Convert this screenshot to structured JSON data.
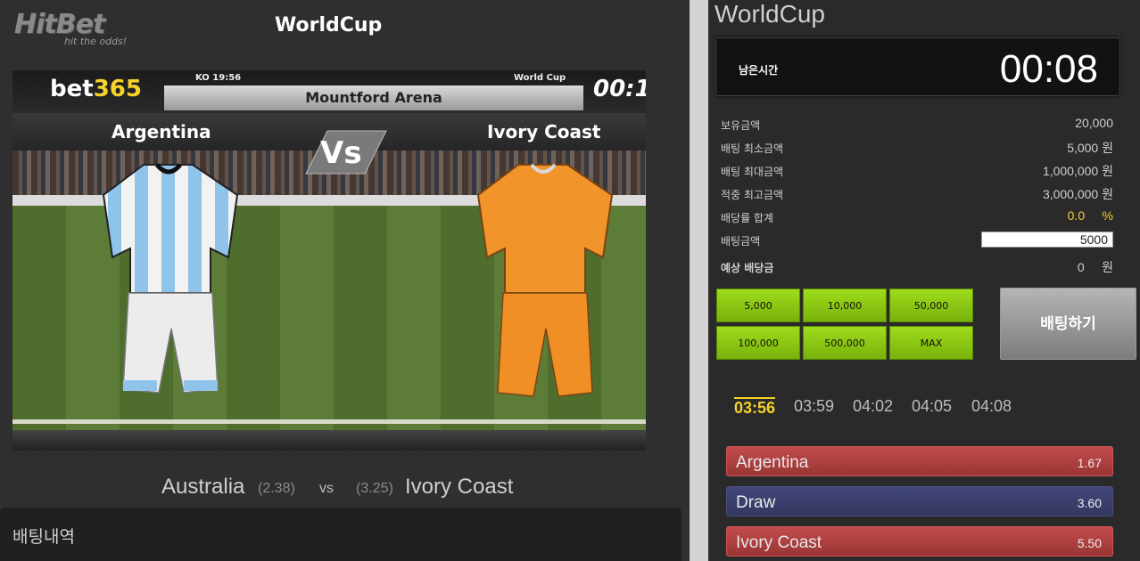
{
  "header": {
    "logo_text": "HitBet",
    "logo_tagline": "hit the odds!",
    "game_title": "WorldCup"
  },
  "video": {
    "brand_prefix": "bet",
    "brand_suffix": "365",
    "kickoff": "KO 19:56",
    "competition": "World Cup",
    "arena": "Mountford Arena",
    "timer": "00:1",
    "team_home": "Argentina",
    "team_away": "Ivory Coast",
    "vs_text": "Vs"
  },
  "match": {
    "team1": "Australia",
    "odd1": "(2.38)",
    "vs": "vs",
    "odd2": "(3.25)",
    "team2": "Ivory Coast"
  },
  "history": {
    "title": "배팅내역"
  },
  "panel": {
    "title": "WorldCup",
    "remaining_label": "남은시간",
    "remaining_time": "00:08",
    "rows": {
      "balance_label": "보유금액",
      "balance_value": "20,000",
      "min_bet_label": "배팅 최소금액",
      "min_bet_value": "5,000 원",
      "max_bet_label": "배팅 최대금액",
      "max_bet_value": "1,000,000 원",
      "max_win_label": "적중 최고금액",
      "max_win_value": "3,000,000 원",
      "odds_sum_label": "배당률 합계",
      "odds_sum_value": "0.0     %",
      "bet_amount_label": "배팅금액",
      "bet_amount_value": "5000",
      "expected_label": "예상 배당금",
      "expected_value": "0     원"
    },
    "amount_buttons": [
      "5,000",
      "10,000",
      "50,000",
      "100,000",
      "500,000",
      "MAX"
    ],
    "bet_button": "배팅하기",
    "times": [
      "03:56",
      "03:59",
      "04:02",
      "04:05",
      "04:08"
    ],
    "active_time_index": 0,
    "odds": [
      {
        "name": "Argentina",
        "value": "1.67",
        "color": "#b04040"
      },
      {
        "name": "Draw",
        "value": "3.60",
        "color": "#3b3f6c"
      },
      {
        "name": "Ivory Coast",
        "value": "5.50",
        "color": "#b04040"
      }
    ]
  },
  "colors": {
    "accent_yellow": "#f5d02a",
    "button_green": "#8ccb14",
    "team_home_kit": "#8fc3ea",
    "team_away_kit": "#f2942c"
  }
}
